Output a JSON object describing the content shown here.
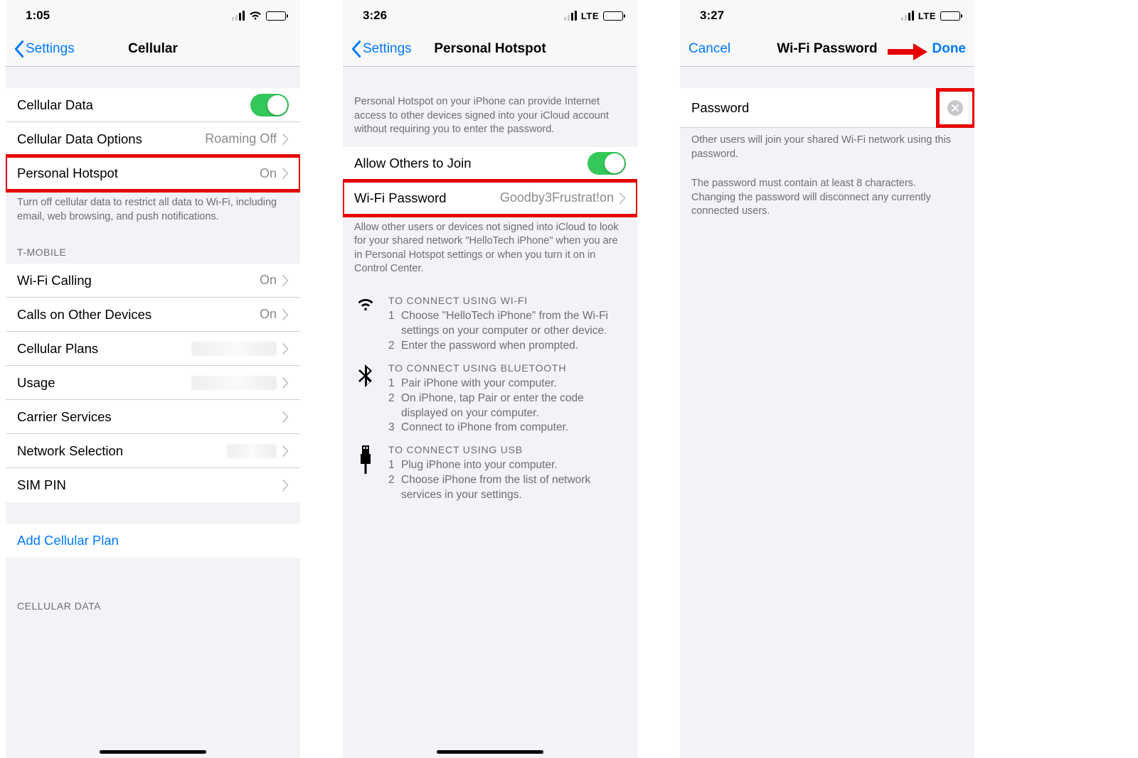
{
  "screen1": {
    "status": {
      "time": "1:05"
    },
    "nav": {
      "back": "Settings",
      "title": "Cellular"
    },
    "rows": {
      "cellularData": "Cellular Data",
      "cellularDataOptions": "Cellular Data Options",
      "cellularDataOptions_val": "Roaming Off",
      "personalHotspot": "Personal Hotspot",
      "personalHotspot_val": "On",
      "wifiCalling": "Wi-Fi Calling",
      "wifiCalling_val": "On",
      "callsOnOther": "Calls on Other Devices",
      "callsOnOther_val": "On",
      "cellularPlans": "Cellular Plans",
      "usage": "Usage",
      "carrierServices": "Carrier Services",
      "networkSelection": "Network Selection",
      "simPin": "SIM PIN",
      "addCellularPlan": "Add Cellular Plan"
    },
    "footer1": "Turn off cellular data to restrict all data to Wi-Fi, including email, web browsing, and push notifications.",
    "header_tmobile": "T-MOBILE",
    "header_cellularData": "CELLULAR DATA"
  },
  "screen2": {
    "status": {
      "time": "3:26",
      "net": "LTE"
    },
    "nav": {
      "back": "Settings",
      "title": "Personal Hotspot"
    },
    "intro": "Personal Hotspot on your iPhone can provide Internet access to other devices signed into your iCloud account without requiring you to enter the password.",
    "rows": {
      "allowOthers": "Allow Others to Join",
      "wifiPassword": "Wi-Fi Password",
      "wifiPassword_val": "Goodby3Frustrat!on"
    },
    "footer2": "Allow other users or devices not signed into iCloud to look for your shared network \"HelloTech iPhone\" when you are in Personal Hotspot settings or when you turn it on in Control Center.",
    "wifi": {
      "title": "TO CONNECT USING WI-FI",
      "s1": "Choose \"HelloTech iPhone\" from the Wi-Fi settings on your computer or other device.",
      "s2": "Enter the password when prompted."
    },
    "bt": {
      "title": "TO CONNECT USING BLUETOOTH",
      "s1": "Pair iPhone with your computer.",
      "s2": "On iPhone, tap Pair or enter the code displayed on your computer.",
      "s3": "Connect to iPhone from computer."
    },
    "usb": {
      "title": "TO CONNECT USING USB",
      "s1": "Plug iPhone into your computer.",
      "s2": "Choose iPhone from the list of network services in your settings."
    }
  },
  "screen3": {
    "status": {
      "time": "3:27",
      "net": "LTE"
    },
    "nav": {
      "cancel": "Cancel",
      "title": "Wi-Fi Password",
      "done": "Done"
    },
    "passwordLabel": "Password",
    "footer1": "Other users will join your shared Wi-Fi network using this password.",
    "footer2": "The password must contain at least 8 characters. Changing the password will disconnect any currently connected users."
  }
}
